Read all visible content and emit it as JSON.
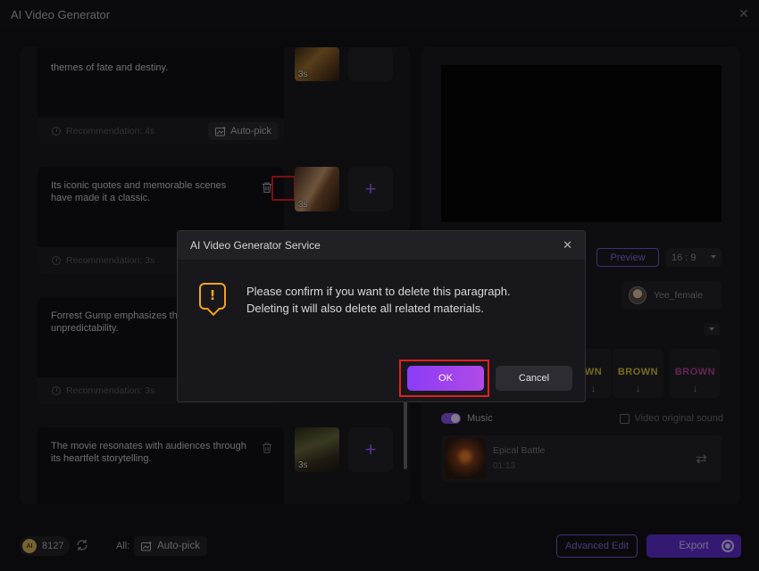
{
  "window": {
    "title": "AI Video Generator"
  },
  "segments": [
    {
      "text": "themes of fate and destiny.",
      "recommendation": "Recommendation: 4s",
      "autopick": "Auto-pick",
      "thumb_duration": "3s"
    },
    {
      "text": "Its iconic quotes and memorable scenes have made it a classic.",
      "recommendation": "Recommendation: 3s",
      "thumb_duration": "3s"
    },
    {
      "text": "Forrest Gump emphasizes the b unpredictability.",
      "recommendation": "Recommendation: 3s"
    },
    {
      "text": "The movie resonates with audiences through its heartfelt storytelling.",
      "thumb_duration": "3s"
    }
  ],
  "right": {
    "preview_label": "Preview",
    "aspect_ratio": "16 : 9",
    "voice_name": "Yee_female",
    "styles": [
      {
        "label": "WN",
        "color": "#d7c236"
      },
      {
        "label": "BROWN",
        "color": "#d7c236"
      },
      {
        "label": "BROWN",
        "color": "#b9449a"
      }
    ],
    "music_label": "Music",
    "music_enabled": true,
    "video_original_sound": "Video original sound",
    "music_track": {
      "name": "Epical Battle",
      "duration": "01:13"
    }
  },
  "bottom": {
    "credits": "8127",
    "coin_label": "AI",
    "all_label": "All:",
    "autopick_label": "Auto-pick",
    "advanced_edit": "Advanced Edit",
    "export": "Export"
  },
  "dialog": {
    "title": "AI Video Generator Service",
    "message_line1": "Please confirm if you want to delete this paragraph.",
    "message_line2": "Deleting it will also delete all related materials.",
    "ok": "OK",
    "cancel": "Cancel"
  },
  "icons": {
    "close": "close-icon",
    "trash": "trash-icon",
    "add": "plus-icon",
    "warning": "warning-icon"
  }
}
